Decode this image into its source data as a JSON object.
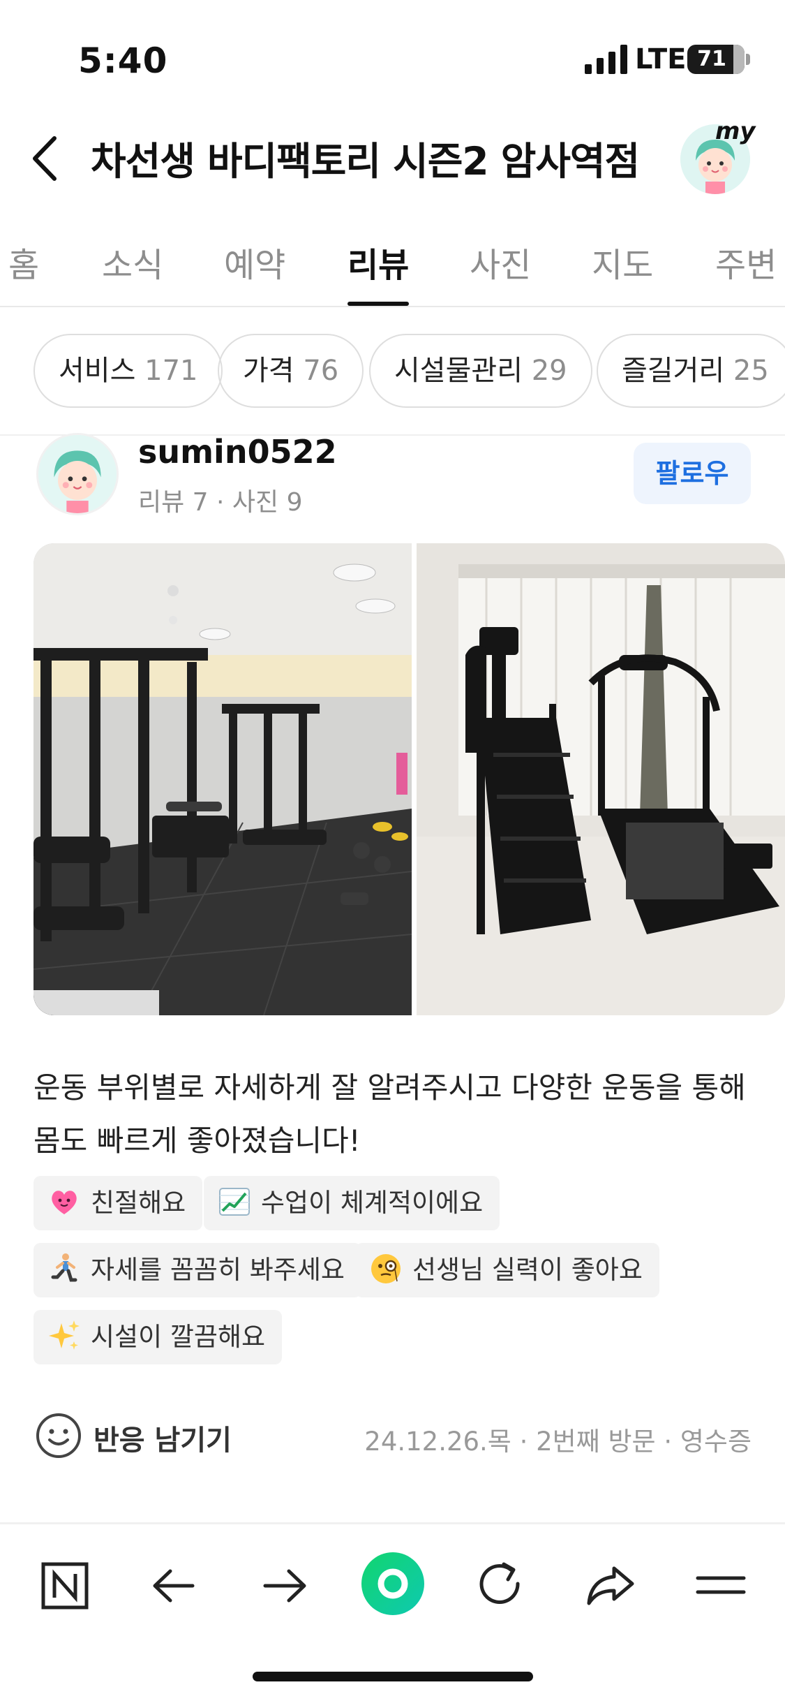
{
  "status_bar": {
    "time": "5:40",
    "network": "LTE",
    "battery": "71"
  },
  "header": {
    "title": "차선생 바디팩토리 시즌2 암사역점",
    "my_label": "my"
  },
  "tabs": [
    {
      "label": "홈"
    },
    {
      "label": "소식"
    },
    {
      "label": "예약"
    },
    {
      "label": "리뷰",
      "active": true
    },
    {
      "label": "사진"
    },
    {
      "label": "지도"
    },
    {
      "label": "주변"
    }
  ],
  "filter_chips": [
    {
      "label": "서비스",
      "count": "171"
    },
    {
      "label": "가격",
      "count": "76"
    },
    {
      "label": "시설물관리",
      "count": "29"
    },
    {
      "label": "즐길거리",
      "count": "25"
    }
  ],
  "review": {
    "username": "sumin0522",
    "meta": "리뷰 7 · 사진 9",
    "follow_label": "팔로우",
    "text": "운동 부위별로 자세하게 잘 알려주시고 다양한 운동을 통해 몸도 빠르게 좋아졌습니다!",
    "tags": [
      {
        "icon": "heart-icon",
        "label": "친절해요"
      },
      {
        "icon": "chart-up-icon",
        "label": "수업이 체계적이에요"
      },
      {
        "icon": "exercise-icon",
        "label": "자세를 꼼꼼히 봐주세요"
      },
      {
        "icon": "monocle-face-icon",
        "label": "선생님 실력이 좋아요"
      },
      {
        "icon": "sparkles-icon",
        "label": "시설이 깔끔해요"
      }
    ],
    "reaction_label": "반응 남기기",
    "visit_meta": "24.12.26.목 · 2번째 방문 · 영수증"
  },
  "colors": {
    "accent_blue": "#1e6fe0",
    "naver_green": "#03c75a"
  },
  "bottom_nav": [
    "naver-logo-icon",
    "back-arrow-icon",
    "forward-arrow-icon",
    "home-green-icon",
    "refresh-icon",
    "share-icon",
    "menu-icon"
  ]
}
